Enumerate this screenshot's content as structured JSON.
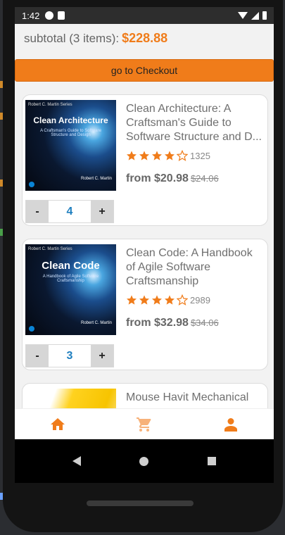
{
  "status": {
    "time": "1:42"
  },
  "cart": {
    "subtotal_label": "subtotal (3 items):",
    "subtotal_value": "$228.88",
    "checkout_label": "go to Checkout"
  },
  "items": [
    {
      "title": "Clean Architecture: A Craftsman's Guide to Software Structure and D...",
      "rating": 4,
      "reviews": "1325",
      "price": "from $20.98",
      "old_price": "$24.06",
      "qty": "4",
      "cover": {
        "series": "Robert C. Martin Series",
        "title": "Clean Architecture",
        "subtitle": "A Craftsman's Guide to Software Structure and Design",
        "author": "Robert C. Martin"
      }
    },
    {
      "title": "Clean Code: A Handbook of Agile Software Craftsmanship",
      "rating": 4,
      "reviews": "2989",
      "price": "from $32.98",
      "old_price": "$34.06",
      "qty": "3",
      "cover": {
        "series": "Robert C. Martin Series",
        "title": "Clean Code",
        "subtitle": "A Handbook of Agile Software Craftsmanship",
        "author": "Robert C. Martin"
      }
    },
    {
      "title": "Mouse Havit Mechanical"
    }
  ],
  "stepper": {
    "minus": "-",
    "plus": "+"
  },
  "nav": {
    "tabs": [
      "home-icon",
      "cart-icon",
      "profile-icon"
    ]
  },
  "colors": {
    "accent": "#f07c1a",
    "qty": "#1f7fbf"
  }
}
